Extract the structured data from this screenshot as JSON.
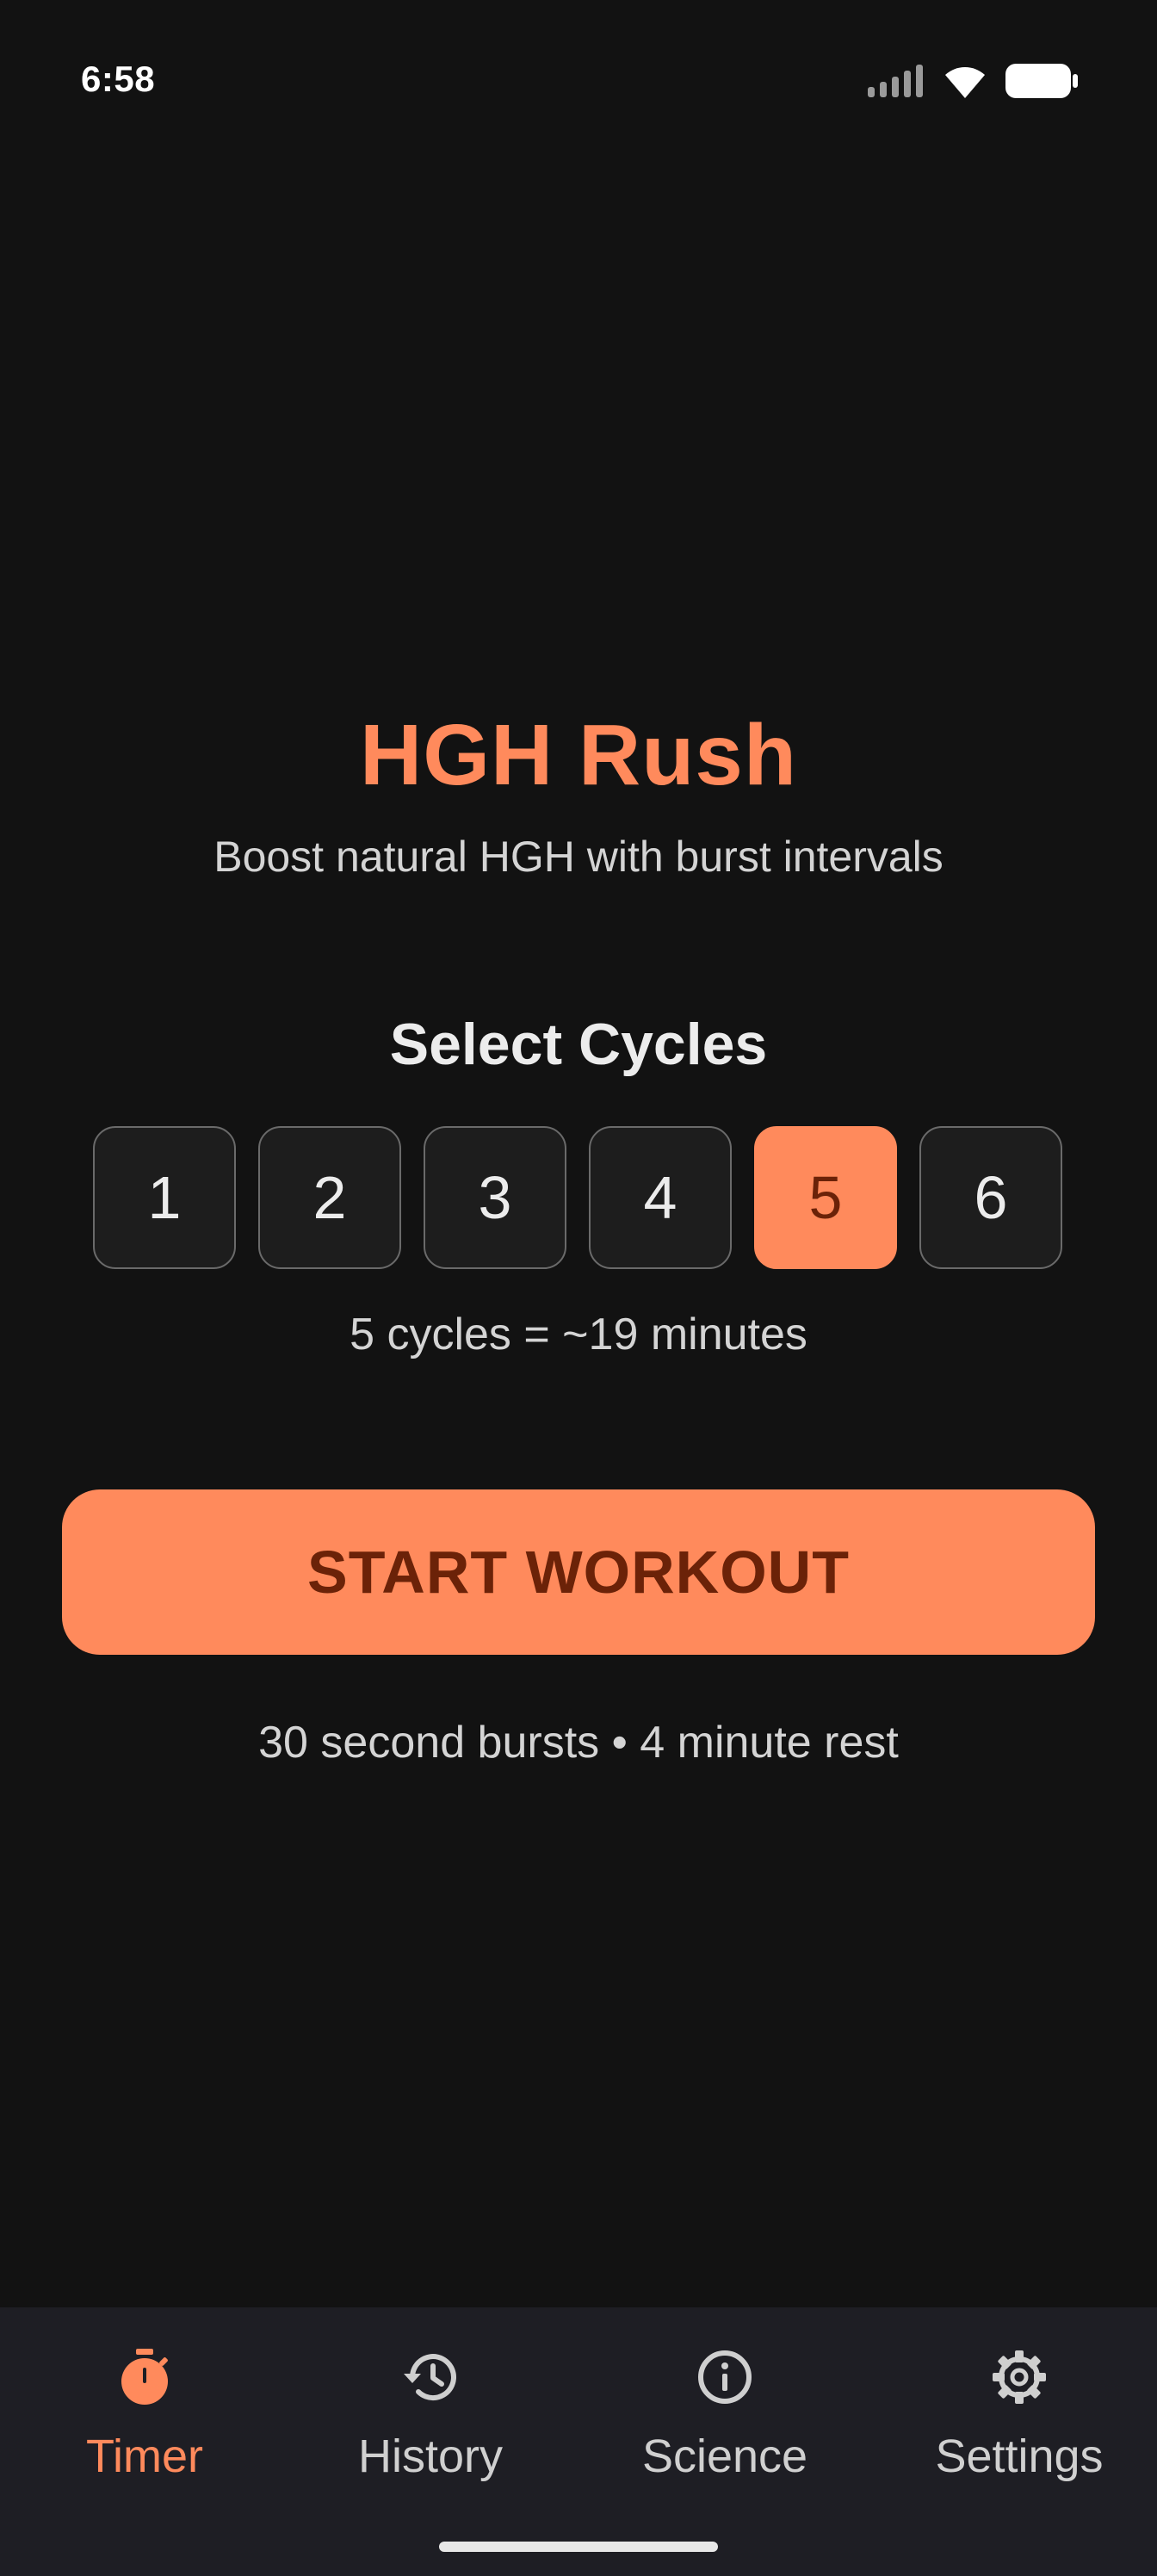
{
  "status_bar": {
    "time": "6:58"
  },
  "header": {
    "title": "HGH Rush",
    "subtitle": "Boost natural HGH with burst intervals"
  },
  "cycles": {
    "heading": "Select Cycles",
    "options": [
      "1",
      "2",
      "3",
      "4",
      "5",
      "6"
    ],
    "selected": "5",
    "summary": "5 cycles = ~19 minutes"
  },
  "start_button": {
    "label": "START WORKOUT"
  },
  "workout_info": "30 second bursts • 4 minute rest",
  "nav": {
    "items": [
      {
        "label": "Timer",
        "icon": "stopwatch-icon",
        "active": true
      },
      {
        "label": "History",
        "icon": "history-icon",
        "active": false
      },
      {
        "label": "Science",
        "icon": "info-icon",
        "active": false
      },
      {
        "label": "Settings",
        "icon": "gear-icon",
        "active": false
      }
    ]
  },
  "colors": {
    "background": "#121212",
    "accent": "#ff8a5c",
    "accent_text": "#6b2208",
    "nav_background": "#1e1e24"
  }
}
